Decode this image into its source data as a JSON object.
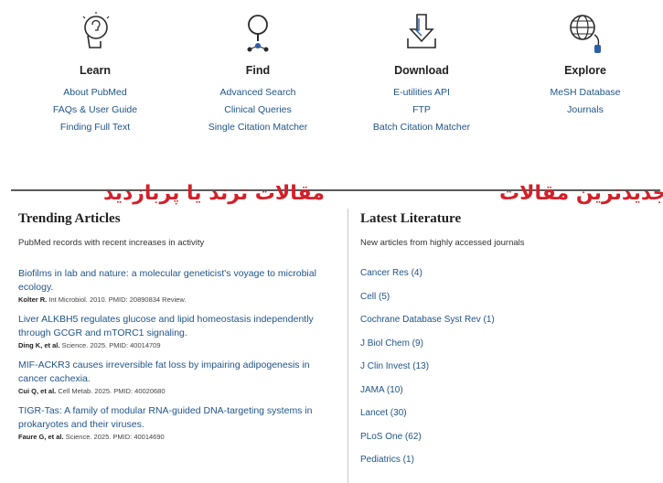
{
  "features": {
    "learn": {
      "icon": "learn-head-icon",
      "heading": "Learn",
      "links": [
        "About PubMed",
        "FAQs & User Guide",
        "Finding Full Text"
      ]
    },
    "find": {
      "icon": "find-magnifier-icon",
      "heading": "Find",
      "links": [
        "Advanced Search",
        "Clinical Queries",
        "Single Citation Matcher"
      ]
    },
    "download": {
      "icon": "download-arrow-icon",
      "heading": "Download",
      "links": [
        "E-utilities API",
        "FTP",
        "Batch Citation Matcher"
      ]
    },
    "explore": {
      "icon": "explore-globe-icon",
      "heading": "Explore",
      "links": [
        "MeSH Database",
        "Journals"
      ]
    }
  },
  "annotations": {
    "trending": "مقالات ترند یا پربازدید",
    "latest": "جدیدترین مقالات",
    "color": "#d4202a"
  },
  "trending": {
    "title": "Trending Articles",
    "subtitle": "PubMed records with recent increases in activity",
    "articles": [
      {
        "title": "Biofilms in lab and nature: a molecular geneticist's voyage to microbial ecology.",
        "author": "Kolter R.",
        "source": "Int Microbiol. 2010. PMID: 20890834 Review."
      },
      {
        "title": "Liver ALKBH5 regulates glucose and lipid homeostasis independently through GCGR and mTORC1 signaling.",
        "author": "Ding K, et al.",
        "source": "Science. 2025. PMID: 40014709"
      },
      {
        "title": "MIF-ACKR3 causes irreversible fat loss by impairing adipogenesis in cancer cachexia.",
        "author": "Cui Q, et al.",
        "source": "Cell Metab. 2025. PMID: 40020680"
      },
      {
        "title": "TIGR-Tas: A family of modular RNA-guided DNA-targeting systems in prokaryotes and their viruses.",
        "author": "Faure G, et al.",
        "source": "Science. 2025. PMID: 40014690"
      }
    ]
  },
  "latest": {
    "title": "Latest Literature",
    "subtitle": "New articles from highly accessed journals",
    "journals": [
      "Cancer Res (4)",
      "Cell (5)",
      "Cochrane Database Syst Rev (1)",
      "J Biol Chem (9)",
      "J Clin Invest (13)",
      "JAMA (10)",
      "Lancet (30)",
      "PLoS One (62)",
      "Pediatrics (1)"
    ]
  },
  "colors": {
    "link": "#20558a",
    "text": "#212121",
    "rule": "#5a5a5a"
  }
}
